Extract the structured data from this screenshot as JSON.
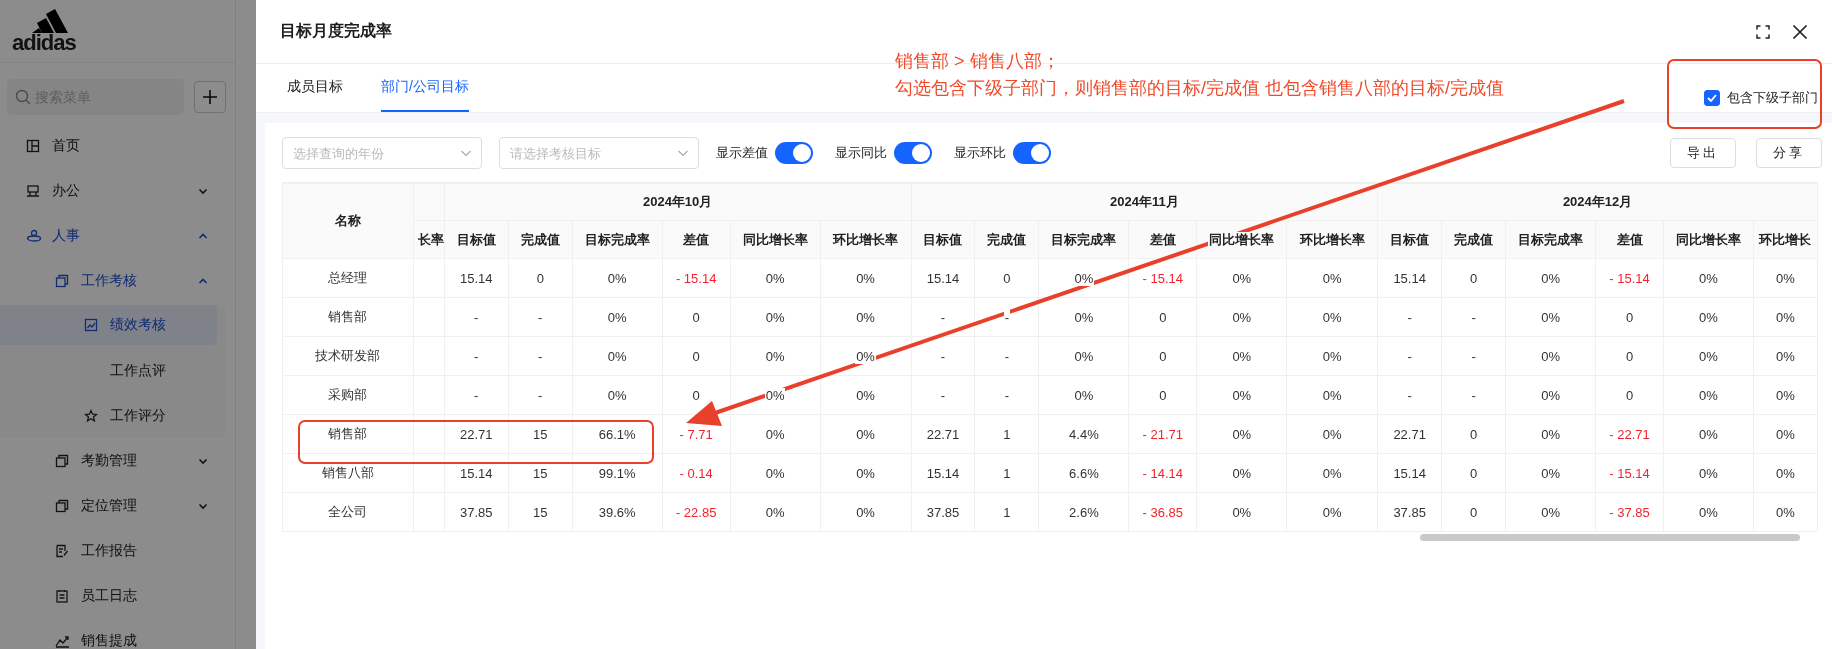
{
  "sidebar": {
    "logo": "adidas",
    "search": {
      "placeholder": "搜索菜单"
    },
    "items": [
      {
        "label": "首页",
        "selected": false
      },
      {
        "label": "办公",
        "selected": false,
        "expanded": false
      },
      {
        "label": "人事",
        "selected": false,
        "expanded": true,
        "children": [
          {
            "label": "工作考核",
            "selected": false,
            "expanded": true,
            "children": [
              {
                "label": "绩效考核",
                "selected": true
              },
              {
                "label": "工作点评",
                "selected": false
              },
              {
                "label": "工作评分",
                "selected": false
              }
            ]
          },
          {
            "label": "考勤管理",
            "selected": false,
            "expanded": false
          },
          {
            "label": "定位管理",
            "selected": false,
            "expanded": false
          },
          {
            "label": "工作报告",
            "selected": false
          },
          {
            "label": "员工日志",
            "selected": false
          },
          {
            "label": "销售提成",
            "selected": false
          }
        ]
      }
    ]
  },
  "drawer": {
    "title": "目标月度完成率",
    "tabs": [
      {
        "label": "成员目标",
        "selected": false
      },
      {
        "label": "部门/公司目标",
        "selected": true
      }
    ],
    "include_subdepartments": {
      "label": "包含下级子部门",
      "checked": true
    },
    "filters": [
      {
        "placeholder": "选择查询的年份"
      },
      {
        "placeholder": "请选择考核目标"
      }
    ],
    "toggles": [
      {
        "label": "显示差值",
        "on": true
      },
      {
        "label": "显示同比",
        "on": true
      },
      {
        "label": "显示环比",
        "on": true
      }
    ],
    "buttons": [
      "导出",
      "分享"
    ],
    "table": {
      "name_header": "名称",
      "cut_column_header": "长率",
      "months": [
        {
          "label": "2024年10月",
          "columns": [
            "目标值",
            "完成值",
            "目标完成率",
            "差值",
            "同比增长率",
            "环比增长率"
          ]
        },
        {
          "label": "2024年11月",
          "columns": [
            "目标值",
            "完成值",
            "目标完成率",
            "差值",
            "同比增长率",
            "环比增长率"
          ]
        },
        {
          "label": "2024年12月",
          "columns": [
            "目标值",
            "完成值",
            "目标完成率",
            "差值",
            "同比增长率",
            "环比增长"
          ]
        }
      ],
      "rows": [
        {
          "name": "总经理",
          "months": [
            {
              "target": "15.14",
              "done": "0",
              "rate": "0%",
              "diff": "- 15.14",
              "diff_negative": true,
              "yoy": "0%",
              "mom": "0%"
            },
            {
              "target": "15.14",
              "done": "0",
              "rate": "0%",
              "diff": "- 15.14",
              "diff_negative": true,
              "yoy": "0%",
              "mom": "0%"
            },
            {
              "target": "15.14",
              "done": "0",
              "rate": "0%",
              "diff": "- 15.14",
              "diff_negative": true,
              "yoy": "0%",
              "mom": "0%"
            }
          ]
        },
        {
          "name": "销售部",
          "months": [
            {
              "target": "-",
              "done": "-",
              "rate": "0%",
              "diff": "0",
              "diff_negative": false,
              "yoy": "0%",
              "mom": "0%"
            },
            {
              "target": "-",
              "done": "-",
              "rate": "0%",
              "diff": "0",
              "diff_negative": false,
              "yoy": "0%",
              "mom": "0%"
            },
            {
              "target": "-",
              "done": "-",
              "rate": "0%",
              "diff": "0",
              "diff_negative": false,
              "yoy": "0%",
              "mom": "0%"
            }
          ]
        },
        {
          "name": "技术研发部",
          "months": [
            {
              "target": "-",
              "done": "-",
              "rate": "0%",
              "diff": "0",
              "diff_negative": false,
              "yoy": "0%",
              "mom": "0%"
            },
            {
              "target": "-",
              "done": "-",
              "rate": "0%",
              "diff": "0",
              "diff_negative": false,
              "yoy": "0%",
              "mom": "0%"
            },
            {
              "target": "-",
              "done": "-",
              "rate": "0%",
              "diff": "0",
              "diff_negative": false,
              "yoy": "0%",
              "mom": "0%"
            }
          ]
        },
        {
          "name": "采购部",
          "months": [
            {
              "target": "-",
              "done": "-",
              "rate": "0%",
              "diff": "0",
              "diff_negative": false,
              "yoy": "0%",
              "mom": "0%"
            },
            {
              "target": "-",
              "done": "-",
              "rate": "0%",
              "diff": "0",
              "diff_negative": false,
              "yoy": "0%",
              "mom": "0%"
            },
            {
              "target": "-",
              "done": "-",
              "rate": "0%",
              "diff": "0",
              "diff_negative": false,
              "yoy": "0%",
              "mom": "0%"
            }
          ]
        },
        {
          "name": "销售部",
          "months": [
            {
              "target": "22.71",
              "done": "15",
              "rate": "66.1%",
              "diff": "- 7.71",
              "diff_negative": true,
              "yoy": "0%",
              "mom": "0%"
            },
            {
              "target": "22.71",
              "done": "1",
              "rate": "4.4%",
              "diff": "- 21.71",
              "diff_negative": true,
              "yoy": "0%",
              "mom": "0%"
            },
            {
              "target": "22.71",
              "done": "0",
              "rate": "0%",
              "diff": "- 22.71",
              "diff_negative": true,
              "yoy": "0%",
              "mom": "0%"
            }
          ]
        },
        {
          "name": "销售八部",
          "months": [
            {
              "target": "15.14",
              "done": "15",
              "rate": "99.1%",
              "diff": "- 0.14",
              "diff_negative": true,
              "yoy": "0%",
              "mom": "0%"
            },
            {
              "target": "15.14",
              "done": "1",
              "rate": "6.6%",
              "diff": "- 14.14",
              "diff_negative": true,
              "yoy": "0%",
              "mom": "0%"
            },
            {
              "target": "15.14",
              "done": "0",
              "rate": "0%",
              "diff": "- 15.14",
              "diff_negative": true,
              "yoy": "0%",
              "mom": "0%"
            }
          ]
        },
        {
          "name": "全公司",
          "months": [
            {
              "target": "37.85",
              "done": "15",
              "rate": "39.6%",
              "diff": "- 22.85",
              "diff_negative": true,
              "yoy": "0%",
              "mom": "0%"
            },
            {
              "target": "37.85",
              "done": "1",
              "rate": "2.6%",
              "diff": "- 36.85",
              "diff_negative": true,
              "yoy": "0%",
              "mom": "0%"
            },
            {
              "target": "37.85",
              "done": "0",
              "rate": "0%",
              "diff": "- 37.85",
              "diff_negative": true,
              "yoy": "0%",
              "mom": "0%"
            }
          ]
        }
      ]
    }
  },
  "annotation": {
    "lines": [
      "销售部 > 销售八部；",
      "勾选包含下级子部门，则销售部的目标/完成值 也包含销售八部的目标/完成值"
    ]
  }
}
